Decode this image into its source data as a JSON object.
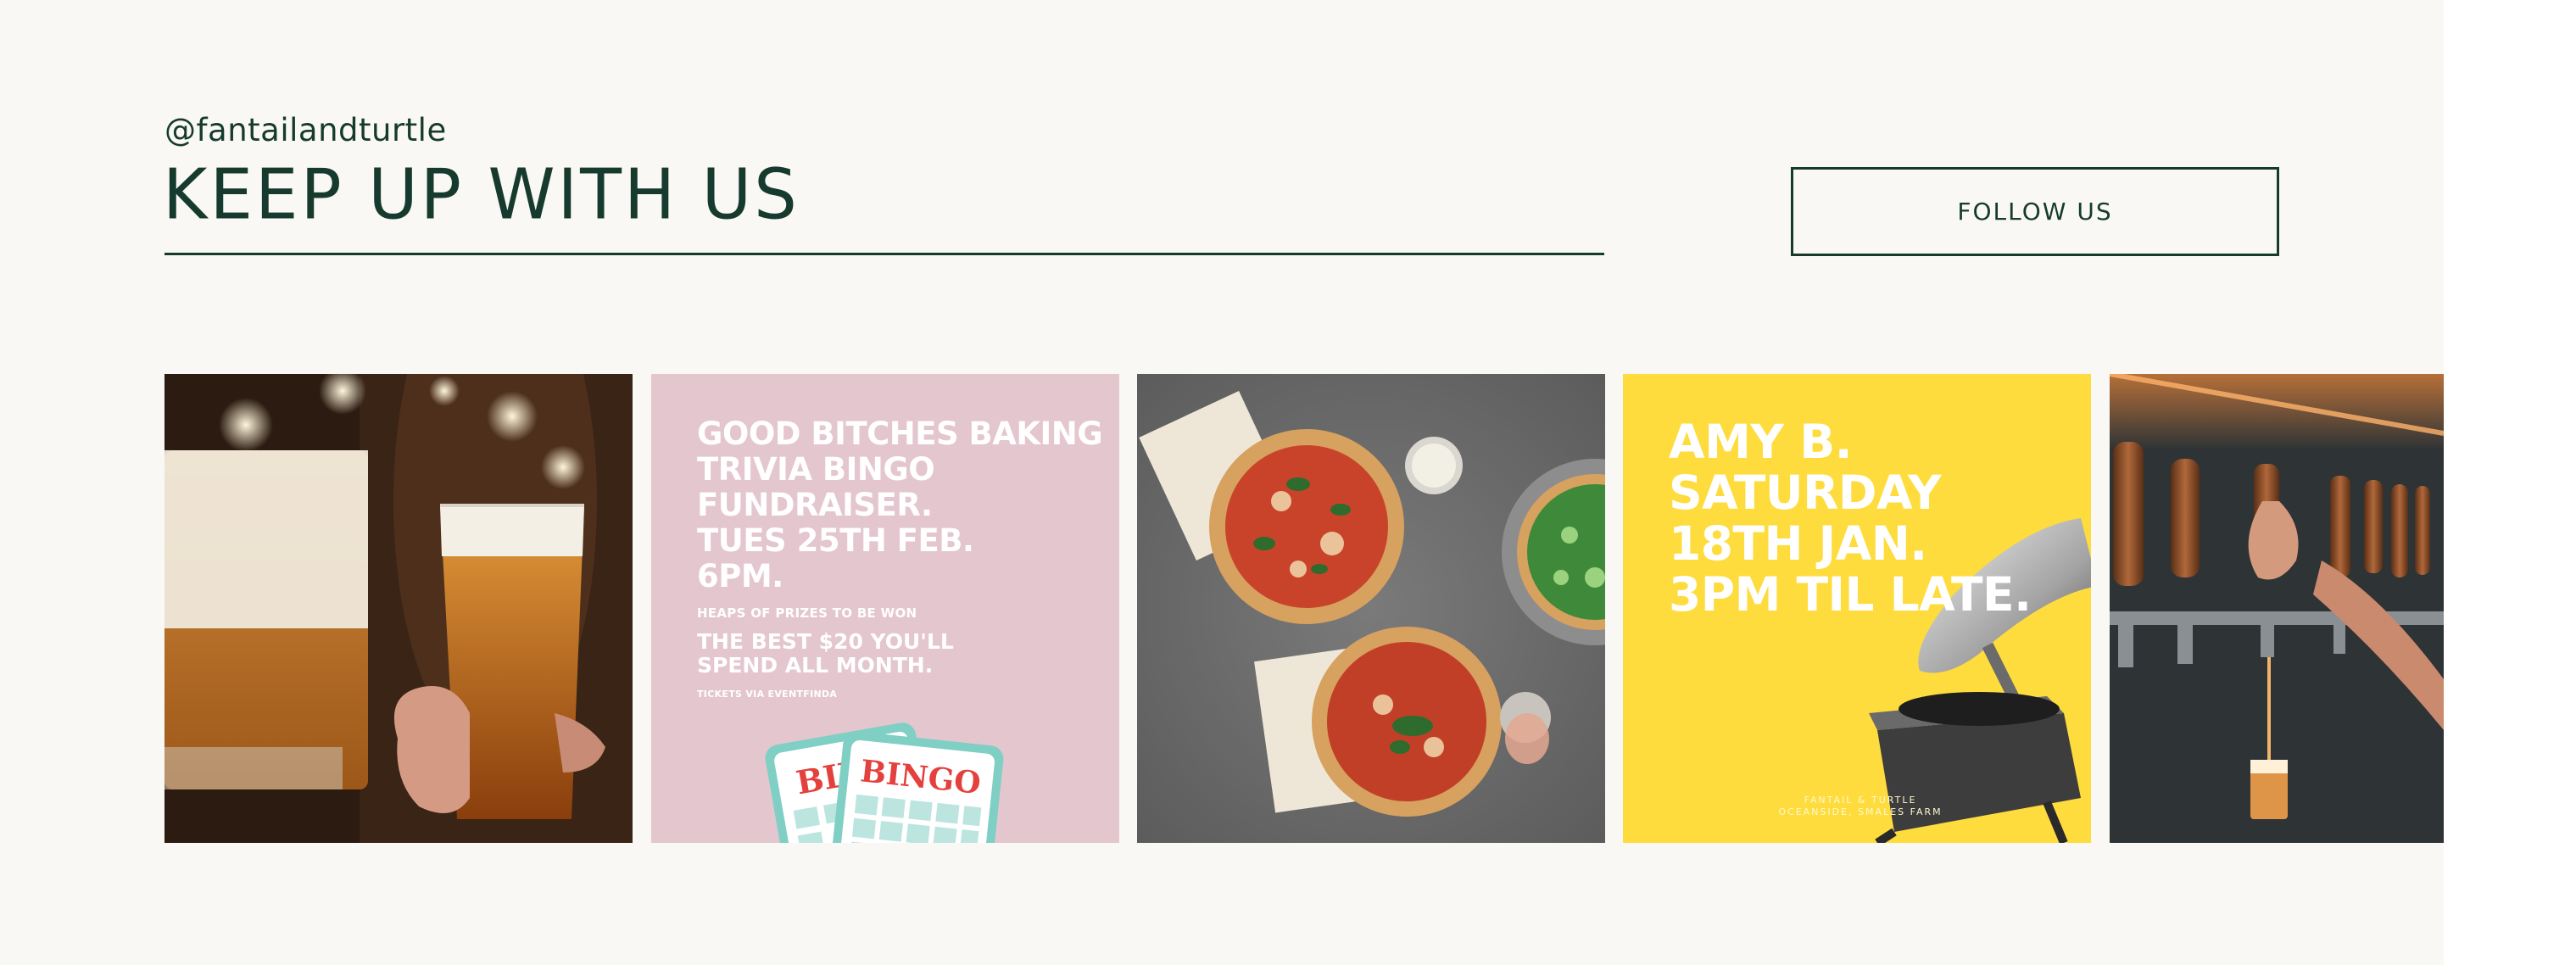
{
  "header": {
    "handle": "@fantailandturtle",
    "title": "KEEP UP WITH US",
    "follow_label": "FOLLOW US"
  },
  "gallery": {
    "bingo_poster": {
      "headline_lines": [
        "GOOD BITCHES BAKING",
        "TRIVIA BINGO",
        "FUNDRAISER.",
        "TUES 25TH FEB.",
        "6PM."
      ],
      "prizes": "HEAPS OF PRIZES TO BE WON",
      "tagline_lines": [
        "THE BEST $20 YOU'LL",
        "SPEND ALL MONTH."
      ],
      "tickets": "TICKETS VIA EVENTFINDA",
      "card_label": "BINGO",
      "card_label_partial": "BING"
    },
    "gig_poster": {
      "headline_lines": [
        "AMY B.",
        "SATURDAY",
        "18TH JAN.",
        "3PM TIL LATE."
      ],
      "credit_lines": [
        "FANTAIL & TURTLE",
        "OCEANSIDE, SMALES FARM"
      ]
    }
  },
  "colors": {
    "page_bg": "#f9f8f4",
    "brand_green": "#173a2e",
    "bingo_pink": "#e4c6cf",
    "gig_yellow": "#fedc3d",
    "bingo_teal": "#7fcfc4",
    "bingo_red": "#e4403d"
  }
}
